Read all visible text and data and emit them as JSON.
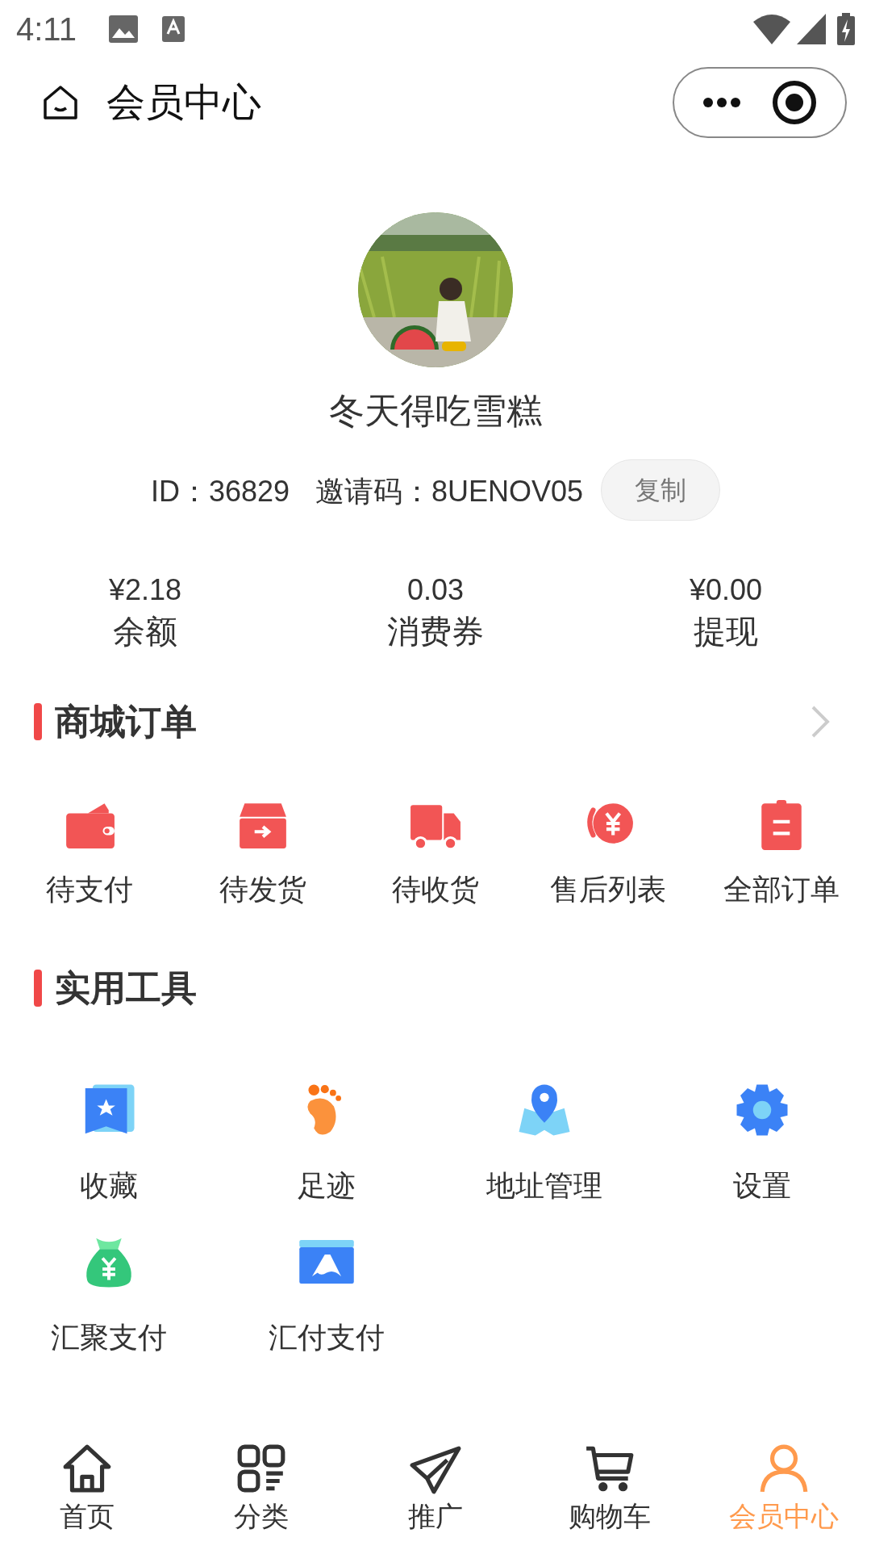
{
  "status_bar": {
    "time": "4:11"
  },
  "nav": {
    "title": "会员中心"
  },
  "profile": {
    "name": "冬天得吃雪糕",
    "id": "ID：36829",
    "invite": "邀请码：8UENOV05",
    "copy_button": "复制"
  },
  "stats": [
    {
      "value": "¥2.18",
      "label": "余额"
    },
    {
      "value": "0.03",
      "label": "消费券"
    },
    {
      "value": "¥0.00",
      "label": "提现"
    }
  ],
  "orders": {
    "title": "商城订单",
    "items": [
      "待支付",
      "待发货",
      "待收货",
      "售后列表",
      "全部订单"
    ]
  },
  "tools": {
    "title": "实用工具",
    "items": [
      "收藏",
      "足迹",
      "地址管理",
      "设置",
      "汇聚支付",
      "汇付支付"
    ]
  },
  "tabs": [
    {
      "label": "首页",
      "selected": false
    },
    {
      "label": "分类",
      "selected": false
    },
    {
      "label": "推广",
      "selected": false
    },
    {
      "label": "购物车",
      "selected": false
    },
    {
      "label": "会员中心",
      "selected": true
    }
  ]
}
